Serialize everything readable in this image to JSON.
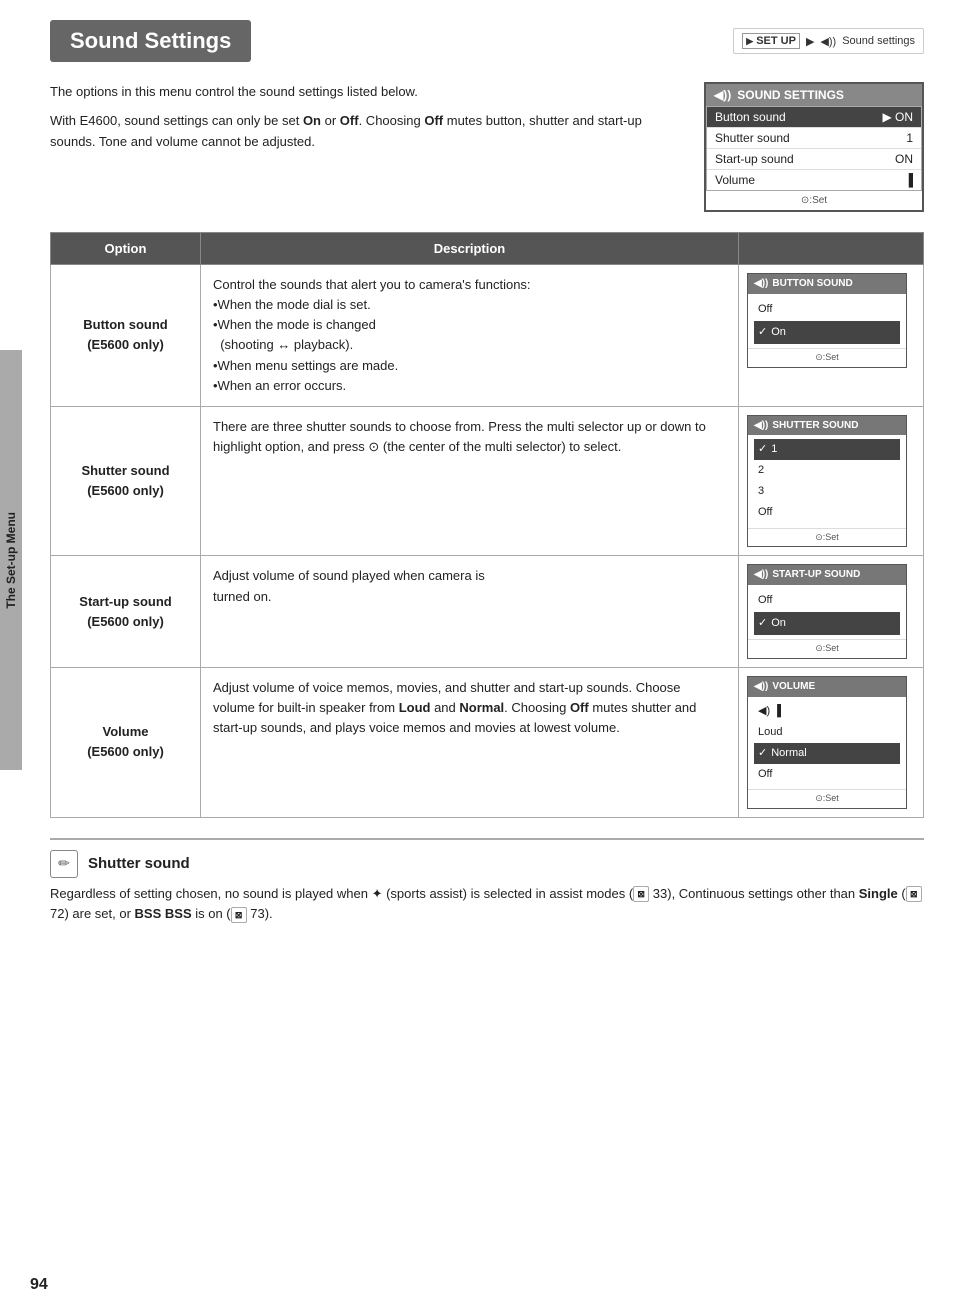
{
  "page": {
    "title": "Sound Settings",
    "number": "94",
    "breadcrumb": {
      "icon": "SET UP",
      "arrow": "▶",
      "label": "Sound settings"
    }
  },
  "sidebar": {
    "label": "The Set-up Menu"
  },
  "intro": {
    "paragraph1": "The options in this menu control the sound settings listed below.",
    "paragraph2": "With E4600, sound settings can only be set On or Off. Choosing Off mutes button, shutter and start-up sounds. Tone and volume cannot be adjusted."
  },
  "sound_settings_menu": {
    "header": "SOUND SETTINGS",
    "rows": [
      {
        "label": "Button sound",
        "value": "ON",
        "selected": true
      },
      {
        "label": "Shutter sound",
        "value": "1",
        "selected": false
      },
      {
        "label": "Start-up sound",
        "value": "ON",
        "selected": false
      },
      {
        "label": "Volume",
        "value": "▐",
        "selected": false
      }
    ],
    "footer": "⊙:Set"
  },
  "table": {
    "col_option": "Option",
    "col_description": "Description",
    "rows": [
      {
        "option": "Button sound\n(E5600 only)",
        "description": "Control the sounds that alert you to camera's functions:\n•When the mode dial is set.\n•When the mode is changed (shooting ↔ playback).\n•When menu settings are made.\n•When an error occurs.",
        "screen_title": "BUTTON SOUND",
        "screen_items": [
          {
            "label": "Off",
            "selected": false,
            "checked": false
          },
          {
            "label": "On",
            "selected": true,
            "checked": true
          }
        ],
        "screen_footer": "⊙:Set"
      },
      {
        "option": "Shutter sound\n(E5600 only)",
        "description": "There are three shutter sounds to choose from. Press the multi selector up or down to highlight option, and press ⊙ (the center of the multi selector) to select.",
        "screen_title": "SHUTTER SOUND",
        "screen_items": [
          {
            "label": "1",
            "selected": true,
            "checked": true
          },
          {
            "label": "2",
            "selected": false,
            "checked": false
          },
          {
            "label": "3",
            "selected": false,
            "checked": false
          },
          {
            "label": "Off",
            "selected": false,
            "checked": false
          }
        ],
        "screen_footer": "⊙:Set"
      },
      {
        "option": "Start-up sound\n(E5600 only)",
        "description": "Adjust volume of sound played when camera is turned on.",
        "screen_title": "START-UP SOUND",
        "screen_items": [
          {
            "label": "Off",
            "selected": false,
            "checked": false
          },
          {
            "label": "On",
            "selected": true,
            "checked": true
          }
        ],
        "screen_footer": "⊙:Set"
      },
      {
        "option": "Volume\n(E5600 only)",
        "description": "Adjust volume of voice memos, movies, and shutter and start-up sounds. Choose volume for built-in speaker from Loud and Normal. Choosing Off mutes shutter and start-up sounds, and plays voice memos and movies at lowest volume.",
        "screen_title": "VOLUME",
        "screen_items": [
          {
            "label": "◀)  ▐",
            "selected": false,
            "checked": false
          },
          {
            "label": "Loud",
            "selected": false,
            "checked": false
          },
          {
            "label": "Normal",
            "selected": true,
            "checked": true
          },
          {
            "label": "Off",
            "selected": false,
            "checked": false
          }
        ],
        "screen_footer": "⊙:Set"
      }
    ]
  },
  "note": {
    "icon": "✏",
    "title": "Shutter sound",
    "text": "Regardless of setting chosen, no sound is played when ✦ (sports assist) is selected in assist modes (⊠ 33), Continuous settings other than Single (⊠ 72) are set, or BSS BSS is on (⊠ 73)."
  }
}
